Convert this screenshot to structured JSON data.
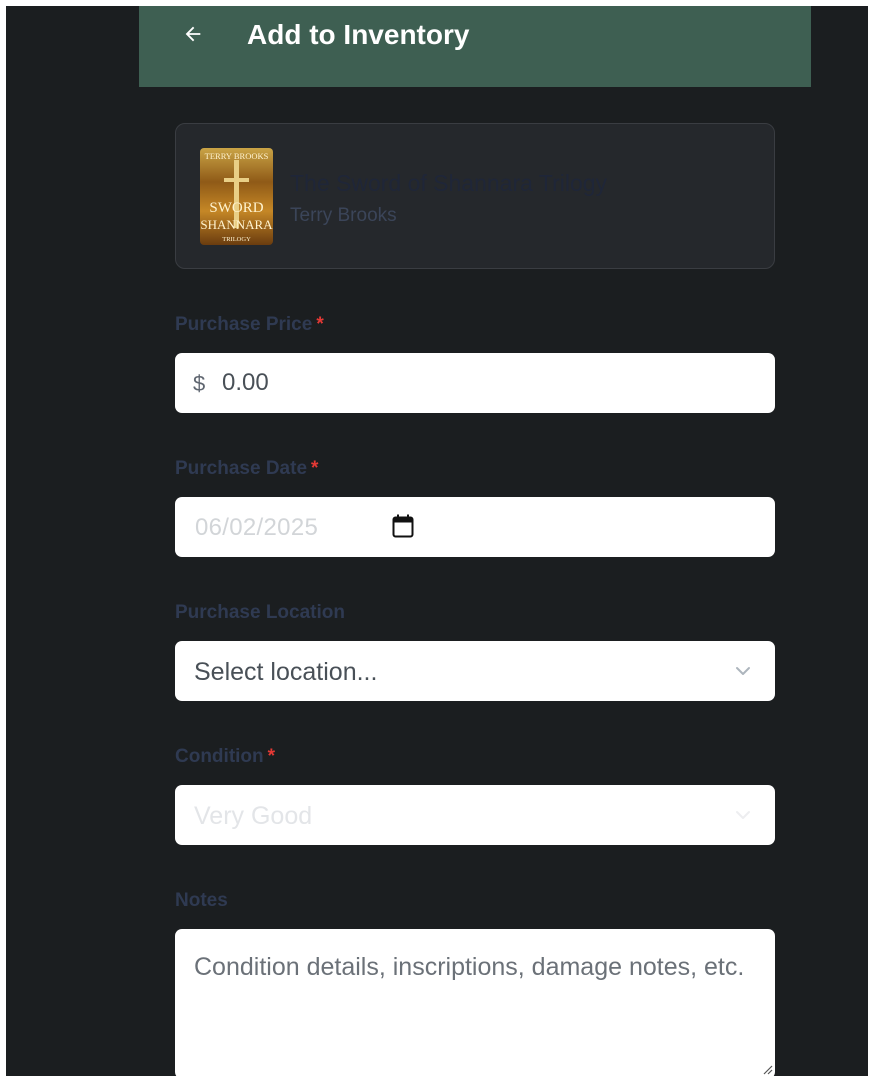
{
  "header": {
    "title": "Add to Inventory",
    "back_icon": "arrow-left-icon"
  },
  "book": {
    "title": "The Sword of Shannara Trilogy",
    "author": "Terry Brooks",
    "cover": {
      "author_text": "TERRY BROOKS",
      "title_line1": "SWORD",
      "title_line2": "SHANNARA",
      "title_line3": "TRILOGY"
    }
  },
  "form": {
    "price": {
      "label": "Purchase Price",
      "required_mark": "*",
      "currency_symbol": "$",
      "value": "0.00"
    },
    "date": {
      "label": "Purchase Date",
      "required_mark": "*",
      "value": "06/02/2025",
      "icon": "calendar-icon"
    },
    "location": {
      "label": "Purchase Location",
      "selected": "Select location...",
      "icon": "chevron-down-icon"
    },
    "condition": {
      "label": "Condition",
      "required_mark": "*",
      "selected": "Very Good",
      "icon": "chevron-down-icon"
    },
    "notes": {
      "label": "Notes",
      "placeholder": "Condition details, inscriptions, damage notes, etc."
    }
  },
  "colors": {
    "header_bg": "#3e5f52",
    "page_bg": "#1b1e20",
    "required": "#e53935"
  }
}
